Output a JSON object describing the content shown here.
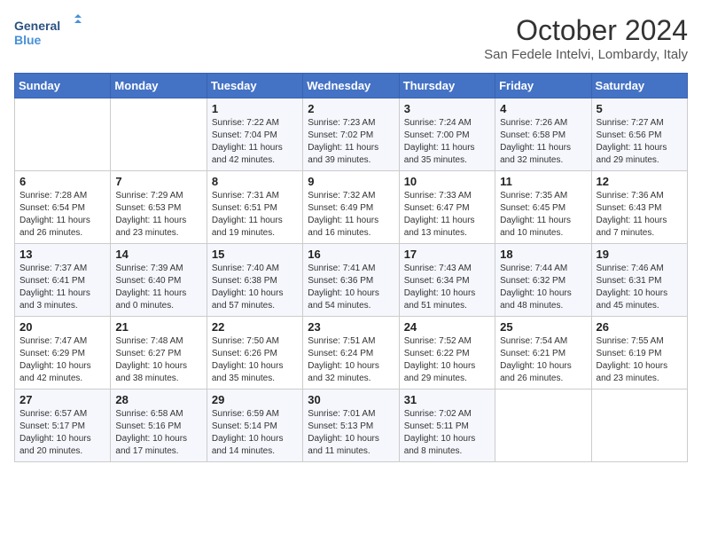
{
  "logo": {
    "line1": "General",
    "line2": "Blue"
  },
  "title": "October 2024",
  "subtitle": "San Fedele Intelvi, Lombardy, Italy",
  "weekdays": [
    "Sunday",
    "Monday",
    "Tuesday",
    "Wednesday",
    "Thursday",
    "Friday",
    "Saturday"
  ],
  "weeks": [
    [
      {
        "day": "",
        "sunrise": "",
        "sunset": "",
        "daylight": ""
      },
      {
        "day": "",
        "sunrise": "",
        "sunset": "",
        "daylight": ""
      },
      {
        "day": "1",
        "sunrise": "Sunrise: 7:22 AM",
        "sunset": "Sunset: 7:04 PM",
        "daylight": "Daylight: 11 hours and 42 minutes."
      },
      {
        "day": "2",
        "sunrise": "Sunrise: 7:23 AM",
        "sunset": "Sunset: 7:02 PM",
        "daylight": "Daylight: 11 hours and 39 minutes."
      },
      {
        "day": "3",
        "sunrise": "Sunrise: 7:24 AM",
        "sunset": "Sunset: 7:00 PM",
        "daylight": "Daylight: 11 hours and 35 minutes."
      },
      {
        "day": "4",
        "sunrise": "Sunrise: 7:26 AM",
        "sunset": "Sunset: 6:58 PM",
        "daylight": "Daylight: 11 hours and 32 minutes."
      },
      {
        "day": "5",
        "sunrise": "Sunrise: 7:27 AM",
        "sunset": "Sunset: 6:56 PM",
        "daylight": "Daylight: 11 hours and 29 minutes."
      }
    ],
    [
      {
        "day": "6",
        "sunrise": "Sunrise: 7:28 AM",
        "sunset": "Sunset: 6:54 PM",
        "daylight": "Daylight: 11 hours and 26 minutes."
      },
      {
        "day": "7",
        "sunrise": "Sunrise: 7:29 AM",
        "sunset": "Sunset: 6:53 PM",
        "daylight": "Daylight: 11 hours and 23 minutes."
      },
      {
        "day": "8",
        "sunrise": "Sunrise: 7:31 AM",
        "sunset": "Sunset: 6:51 PM",
        "daylight": "Daylight: 11 hours and 19 minutes."
      },
      {
        "day": "9",
        "sunrise": "Sunrise: 7:32 AM",
        "sunset": "Sunset: 6:49 PM",
        "daylight": "Daylight: 11 hours and 16 minutes."
      },
      {
        "day": "10",
        "sunrise": "Sunrise: 7:33 AM",
        "sunset": "Sunset: 6:47 PM",
        "daylight": "Daylight: 11 hours and 13 minutes."
      },
      {
        "day": "11",
        "sunrise": "Sunrise: 7:35 AM",
        "sunset": "Sunset: 6:45 PM",
        "daylight": "Daylight: 11 hours and 10 minutes."
      },
      {
        "day": "12",
        "sunrise": "Sunrise: 7:36 AM",
        "sunset": "Sunset: 6:43 PM",
        "daylight": "Daylight: 11 hours and 7 minutes."
      }
    ],
    [
      {
        "day": "13",
        "sunrise": "Sunrise: 7:37 AM",
        "sunset": "Sunset: 6:41 PM",
        "daylight": "Daylight: 11 hours and 3 minutes."
      },
      {
        "day": "14",
        "sunrise": "Sunrise: 7:39 AM",
        "sunset": "Sunset: 6:40 PM",
        "daylight": "Daylight: 11 hours and 0 minutes."
      },
      {
        "day": "15",
        "sunrise": "Sunrise: 7:40 AM",
        "sunset": "Sunset: 6:38 PM",
        "daylight": "Daylight: 10 hours and 57 minutes."
      },
      {
        "day": "16",
        "sunrise": "Sunrise: 7:41 AM",
        "sunset": "Sunset: 6:36 PM",
        "daylight": "Daylight: 10 hours and 54 minutes."
      },
      {
        "day": "17",
        "sunrise": "Sunrise: 7:43 AM",
        "sunset": "Sunset: 6:34 PM",
        "daylight": "Daylight: 10 hours and 51 minutes."
      },
      {
        "day": "18",
        "sunrise": "Sunrise: 7:44 AM",
        "sunset": "Sunset: 6:32 PM",
        "daylight": "Daylight: 10 hours and 48 minutes."
      },
      {
        "day": "19",
        "sunrise": "Sunrise: 7:46 AM",
        "sunset": "Sunset: 6:31 PM",
        "daylight": "Daylight: 10 hours and 45 minutes."
      }
    ],
    [
      {
        "day": "20",
        "sunrise": "Sunrise: 7:47 AM",
        "sunset": "Sunset: 6:29 PM",
        "daylight": "Daylight: 10 hours and 42 minutes."
      },
      {
        "day": "21",
        "sunrise": "Sunrise: 7:48 AM",
        "sunset": "Sunset: 6:27 PM",
        "daylight": "Daylight: 10 hours and 38 minutes."
      },
      {
        "day": "22",
        "sunrise": "Sunrise: 7:50 AM",
        "sunset": "Sunset: 6:26 PM",
        "daylight": "Daylight: 10 hours and 35 minutes."
      },
      {
        "day": "23",
        "sunrise": "Sunrise: 7:51 AM",
        "sunset": "Sunset: 6:24 PM",
        "daylight": "Daylight: 10 hours and 32 minutes."
      },
      {
        "day": "24",
        "sunrise": "Sunrise: 7:52 AM",
        "sunset": "Sunset: 6:22 PM",
        "daylight": "Daylight: 10 hours and 29 minutes."
      },
      {
        "day": "25",
        "sunrise": "Sunrise: 7:54 AM",
        "sunset": "Sunset: 6:21 PM",
        "daylight": "Daylight: 10 hours and 26 minutes."
      },
      {
        "day": "26",
        "sunrise": "Sunrise: 7:55 AM",
        "sunset": "Sunset: 6:19 PM",
        "daylight": "Daylight: 10 hours and 23 minutes."
      }
    ],
    [
      {
        "day": "27",
        "sunrise": "Sunrise: 6:57 AM",
        "sunset": "Sunset: 5:17 PM",
        "daylight": "Daylight: 10 hours and 20 minutes."
      },
      {
        "day": "28",
        "sunrise": "Sunrise: 6:58 AM",
        "sunset": "Sunset: 5:16 PM",
        "daylight": "Daylight: 10 hours and 17 minutes."
      },
      {
        "day": "29",
        "sunrise": "Sunrise: 6:59 AM",
        "sunset": "Sunset: 5:14 PM",
        "daylight": "Daylight: 10 hours and 14 minutes."
      },
      {
        "day": "30",
        "sunrise": "Sunrise: 7:01 AM",
        "sunset": "Sunset: 5:13 PM",
        "daylight": "Daylight: 10 hours and 11 minutes."
      },
      {
        "day": "31",
        "sunrise": "Sunrise: 7:02 AM",
        "sunset": "Sunset: 5:11 PM",
        "daylight": "Daylight: 10 hours and 8 minutes."
      },
      {
        "day": "",
        "sunrise": "",
        "sunset": "",
        "daylight": ""
      },
      {
        "day": "",
        "sunrise": "",
        "sunset": "",
        "daylight": ""
      }
    ]
  ]
}
